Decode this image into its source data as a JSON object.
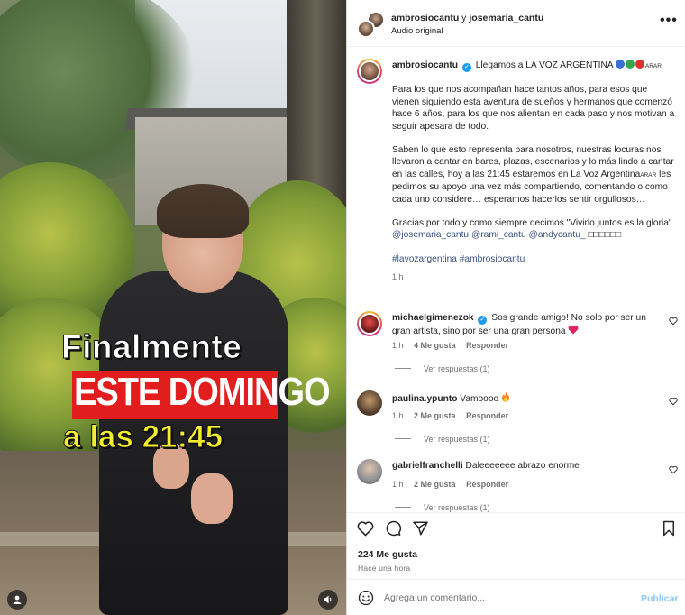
{
  "video": {
    "caption_line1": "Finalmente",
    "caption_line2": "ESTE DOMINGO",
    "caption_line3": "a las 21:45",
    "icons": [
      "user-tag-icon",
      "speaker-icon"
    ]
  },
  "header": {
    "user1": "ambrosiocantu",
    "joiner": " y ",
    "user2": "josemaria_cantu",
    "audio": "Audio original",
    "more": "•••"
  },
  "caption": {
    "username": "ambrosiocantu",
    "title": "Llegamos a LA VOZ ARGENTINA",
    "circle_colors": [
      "#3b6fd6",
      "#2fa84f",
      "#e03131"
    ],
    "flag_text": "ARAR",
    "paragraph1": "Para los que nos acompañan hace tantos años, para esos que vienen siguiendo esta aventura de sueños y hermanos que comenzó hace 6 años, para los que nos alientan en cada paso y nos motivan a seguir apesara de todo.",
    "paragraph2a": "Saben lo que esto representa para nosotros, nuestras locuras nos llevaron a cantar en bares, plazas, escenarios y lo más lindo a cantar en las calles, hoy a las 21:45 estaremos en La Voz Argentina",
    "paragraph2_flag": "ARAR",
    "paragraph2b": " les pedimos su apoyo una vez más compartiendo, comentando o como cada uno considere… esperamos hacerlos sentir orgullosos…",
    "paragraph3": "Gracias por todo y como siempre decimos \"Vivirlo juntos es la gloria\" ",
    "mentions": [
      "@josemaria_cantu",
      "@rami_cantu",
      "@andycantu_"
    ],
    "mention_tail": " □□□□□□",
    "hashtags": "#lavozargentina #ambrosiocantu",
    "time": "1 h"
  },
  "comments": [
    {
      "username": "michaelgimenezok",
      "text": "Sos grande amigo! No solo por ser un gran artista, sino por ser una gran persona",
      "time": "1 h",
      "likes": "4 Me gusta",
      "reply": "Responder",
      "replies": "Ver respuestas (1)"
    },
    {
      "username": "paulina.ypunto",
      "text": "Vamoooo",
      "time": "1 h",
      "likes": "2 Me gusta",
      "reply": "Responder",
      "replies": "Ver respuestas (1)"
    },
    {
      "username": "gabrielfranchelli",
      "text": "Daleeeeeee abrazo enorme",
      "time": "1 h",
      "likes": "2 Me gusta",
      "reply": "Responder",
      "replies": "Ver respuestas (1)"
    }
  ],
  "actions": {
    "likes": "224 Me gusta",
    "ago": "Hace una hora"
  },
  "composer": {
    "placeholder": "Agrega un comentario...",
    "post": "Publicar"
  },
  "colors": {
    "link": "#385185",
    "muted": "#737373",
    "post_disabled": "#8fc5f7",
    "verified": "#1d9bf0"
  }
}
